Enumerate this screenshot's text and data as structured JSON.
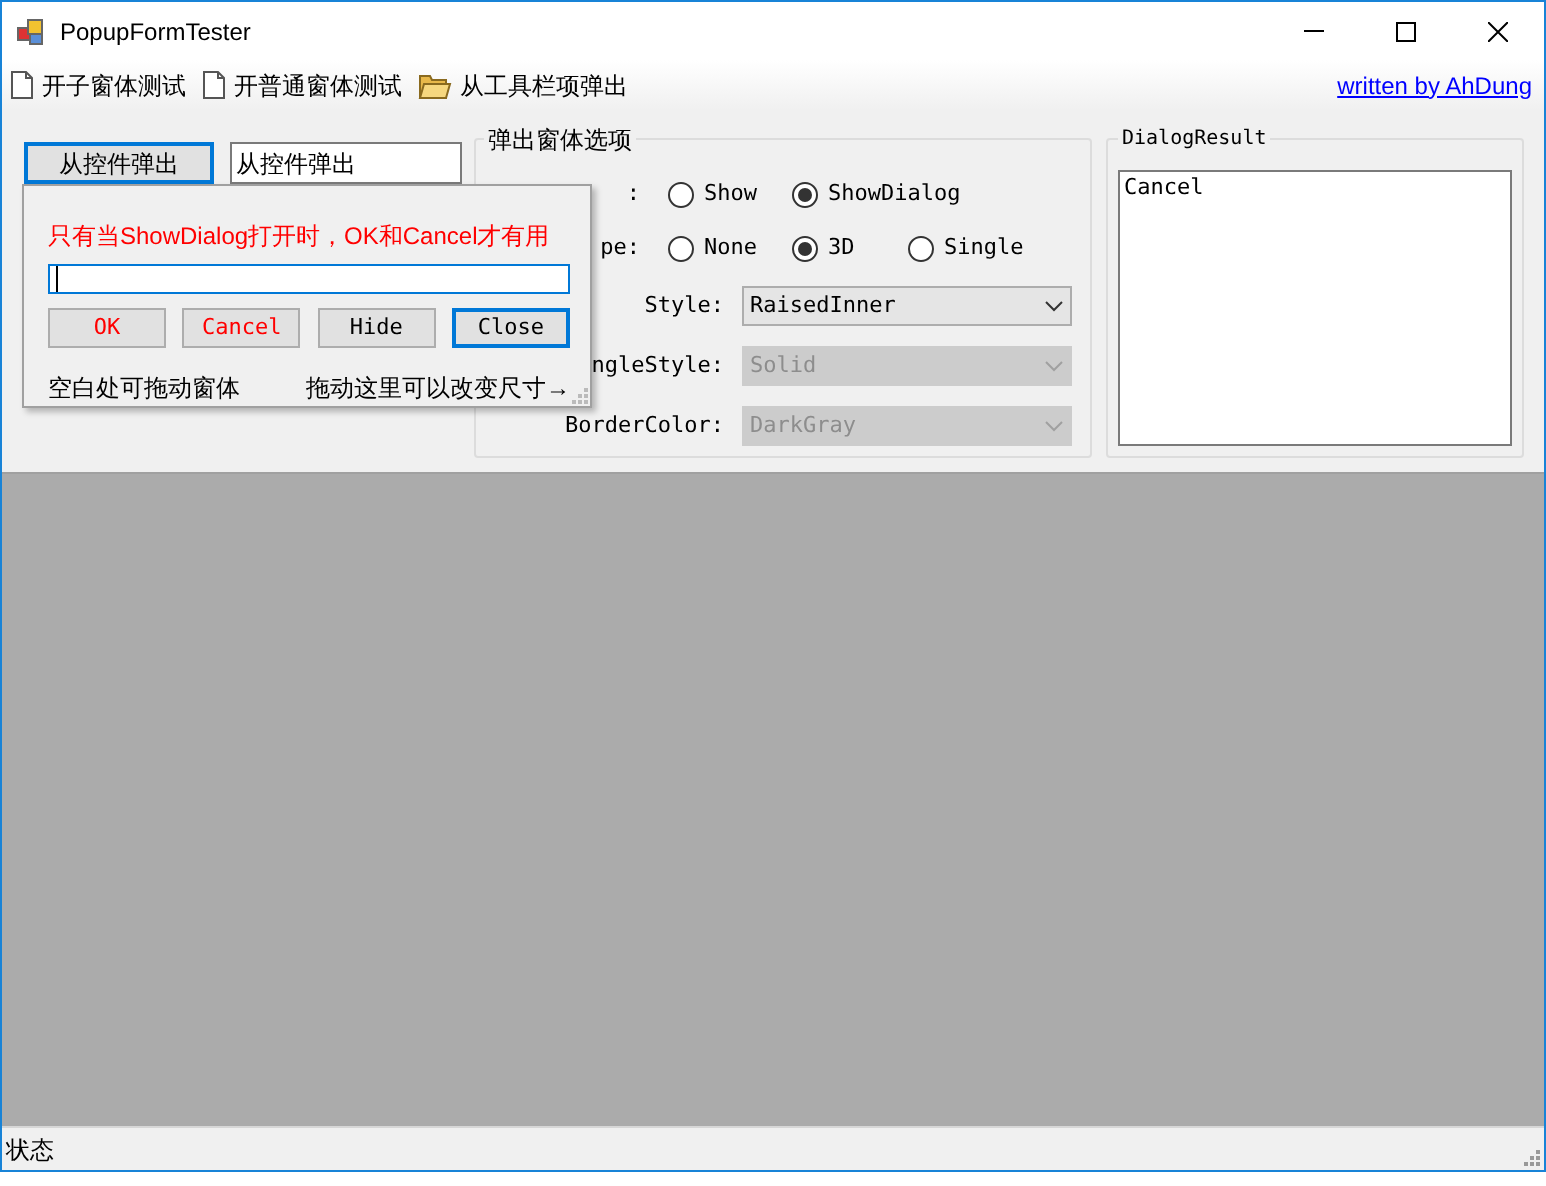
{
  "window": {
    "title": "PopupFormTester"
  },
  "toolbar": {
    "items": [
      {
        "label": "开子窗体测试",
        "kind": "page"
      },
      {
        "label": "开普通窗体测试",
        "kind": "page"
      },
      {
        "label": "从工具栏项弹出",
        "kind": "folder"
      }
    ],
    "link": "written by AhDung"
  },
  "top": {
    "button": "从控件弹出",
    "field_value": "从控件弹出"
  },
  "popup": {
    "note": "只有当ShowDialog打开时，OK和Cancel才有用",
    "buttons": [
      {
        "label": "OK",
        "red": true,
        "focused": false
      },
      {
        "label": "Cancel",
        "red": true,
        "focused": false
      },
      {
        "label": "Hide",
        "red": false,
        "focused": false
      },
      {
        "label": "Close",
        "red": false,
        "focused": true
      }
    ],
    "drag_hint": "空白处可拖动窗体",
    "resize_hint": "拖动这里可以改变尺寸→"
  },
  "options": {
    "title": "弹出窗体选项",
    "rows": [
      {
        "label": ":",
        "kind": "radio",
        "options": [
          {
            "label": "Show",
            "selected": false
          },
          {
            "label": "ShowDialog",
            "selected": true
          }
        ]
      },
      {
        "label": "pe:",
        "kind": "radio",
        "options": [
          {
            "label": "None",
            "selected": false
          },
          {
            "label": "3D",
            "selected": true
          },
          {
            "label": "Single",
            "selected": false
          }
        ]
      },
      {
        "label": "Style:",
        "kind": "select",
        "value": "RaisedInner",
        "disabled": false
      },
      {
        "label": "ngleStyle:",
        "kind": "select",
        "value": "Solid",
        "disabled": true
      },
      {
        "label": "BorderColor:",
        "kind": "select",
        "value": "DarkGray",
        "disabled": true
      }
    ]
  },
  "result": {
    "title": "DialogResult",
    "value": "Cancel"
  },
  "status_bar": {
    "text": "状态"
  }
}
